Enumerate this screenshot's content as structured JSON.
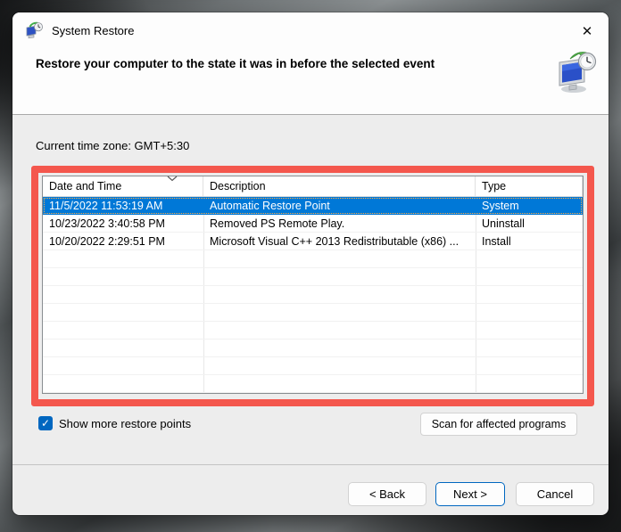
{
  "window": {
    "title": "System Restore"
  },
  "header": {
    "instruction": "Restore your computer to the state it was in before the selected event"
  },
  "timezone": {
    "label": "Current time zone: GMT+5:30"
  },
  "table": {
    "columns": [
      "Date and Time",
      "Description",
      "Type"
    ],
    "sorted_column": "Date and Time",
    "sort_direction": "descending",
    "rows": [
      {
        "date": "11/5/2022 11:53:19 AM",
        "description": "Automatic Restore Point",
        "type": "System",
        "selected": true
      },
      {
        "date": "10/23/2022 3:40:58 PM",
        "description": "Removed PS Remote Play.",
        "type": "Uninstall",
        "selected": false
      },
      {
        "date": "10/20/2022 2:29:51 PM",
        "description": "Microsoft Visual C++ 2013 Redistributable (x86) ...",
        "type": "Install",
        "selected": false
      }
    ],
    "empty_row_count": 8
  },
  "controls": {
    "show_more_label": "Show more restore points",
    "show_more_checked": true,
    "scan_button_label": "Scan for affected programs"
  },
  "footer": {
    "back_label": "< Back",
    "next_label": "Next >",
    "cancel_label": "Cancel"
  },
  "icons": {
    "close": "✕",
    "check": "✓"
  },
  "colors": {
    "selection_blue": "#0078d7",
    "accent_blue": "#0067c0",
    "annotation_red": "#f4574d"
  }
}
